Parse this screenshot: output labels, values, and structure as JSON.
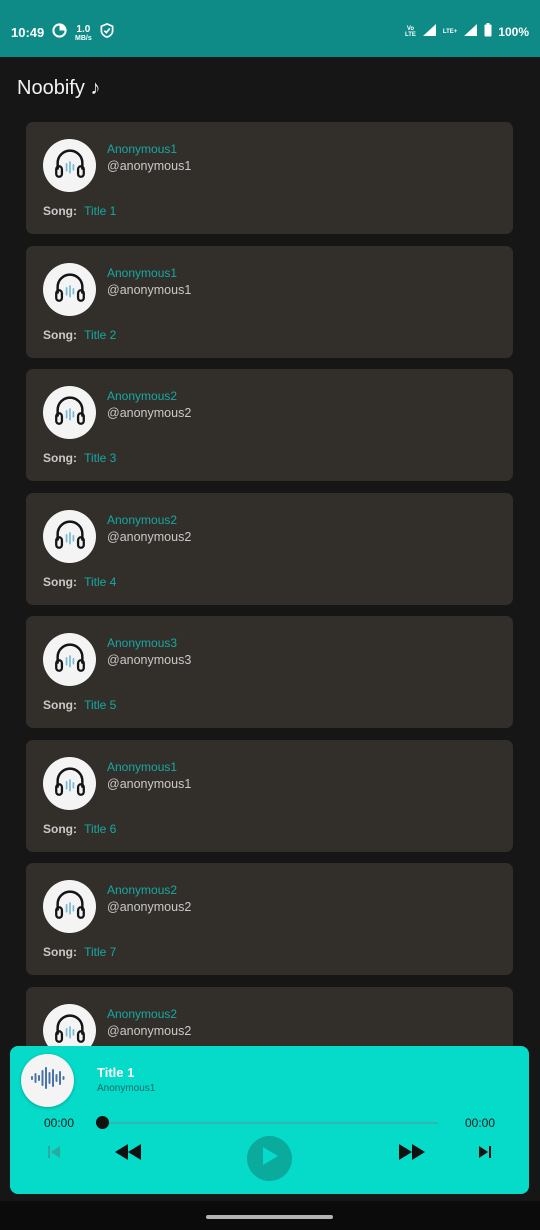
{
  "status_bar": {
    "time": "10:49",
    "speed_value": "1.0",
    "speed_unit": "MB/s",
    "volte_label_top": "Vo",
    "volte_label_bottom": "LTE",
    "lte_label": "LTE+",
    "battery": "100%",
    "icons": [
      "data-saver-icon",
      "shield-icon",
      "signal-icon",
      "battery-icon"
    ]
  },
  "app": {
    "title": "Noobify ♪"
  },
  "song_label": "Song:",
  "songs": [
    {
      "artist": "Anonymous1",
      "handle": "@anonymous1",
      "title": "Title 1"
    },
    {
      "artist": "Anonymous1",
      "handle": "@anonymous1",
      "title": "Title 2"
    },
    {
      "artist": "Anonymous2",
      "handle": "@anonymous2",
      "title": "Title 3"
    },
    {
      "artist": "Anonymous2",
      "handle": "@anonymous2",
      "title": "Title 4"
    },
    {
      "artist": "Anonymous3",
      "handle": "@anonymous3",
      "title": "Title 5"
    },
    {
      "artist": "Anonymous1",
      "handle": "@anonymous1",
      "title": "Title 6"
    },
    {
      "artist": "Anonymous2",
      "handle": "@anonymous2",
      "title": "Title 7"
    },
    {
      "artist": "Anonymous2",
      "handle": "@anonymous2",
      "title": ""
    }
  ],
  "player": {
    "title": "Title 1",
    "artist": "Anonymous1",
    "time_current": "00:00",
    "time_total": "00:00",
    "progress": 0,
    "controls": [
      "skip-previous-icon",
      "rewind-icon",
      "play-icon",
      "fast-forward-icon",
      "skip-next-icon"
    ]
  },
  "colors": {
    "status_bar": "#0e8a87",
    "background": "#161616",
    "card": "#322f2a",
    "accent_text": "#17a8a2",
    "player": "#06dac8",
    "play_button": "#0aaa9c"
  }
}
